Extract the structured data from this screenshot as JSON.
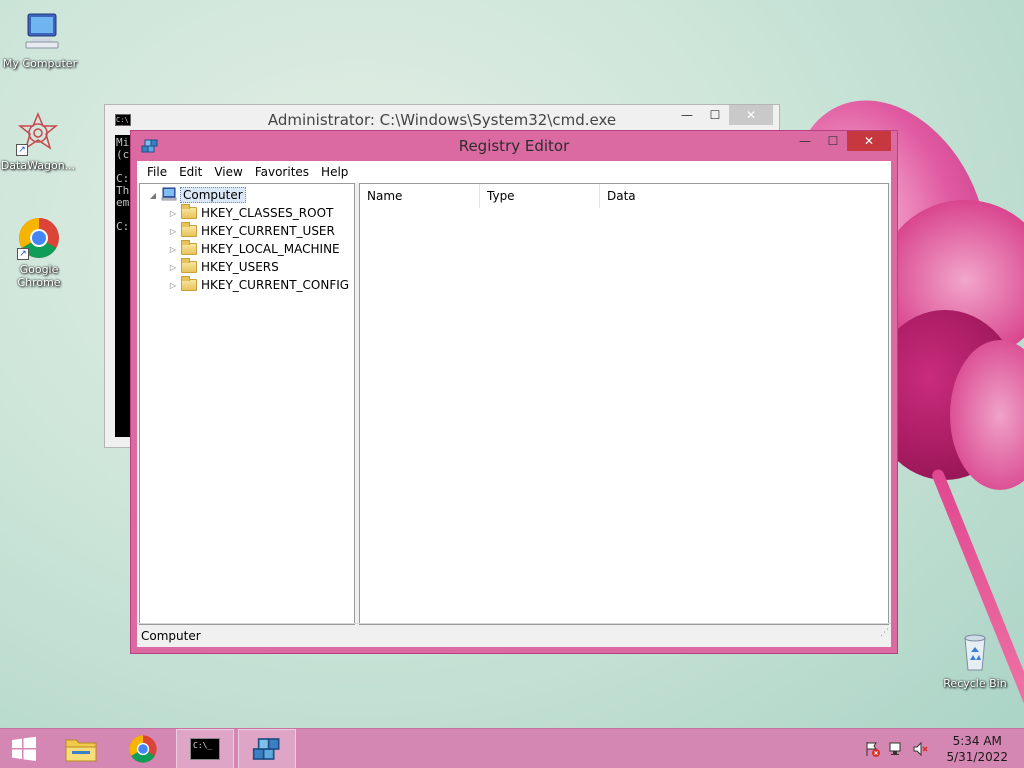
{
  "desktop": {
    "icons": [
      {
        "label": "My Computer"
      },
      {
        "label": "DataWagon..."
      },
      {
        "label": "Google Chrome"
      },
      {
        "label": "Recycle Bin"
      }
    ]
  },
  "cmd_window": {
    "title": "Administrator: C:\\Windows\\System32\\cmd.exe",
    "console_lines": [
      "Mi",
      "(c",
      "",
      "C:",
      "Th",
      "em",
      "",
      "C:"
    ]
  },
  "regedit": {
    "title": "Registry Editor",
    "menu": [
      "File",
      "Edit",
      "View",
      "Favorites",
      "Help"
    ],
    "tree_root": "Computer",
    "tree_items": [
      "HKEY_CLASSES_ROOT",
      "HKEY_CURRENT_USER",
      "HKEY_LOCAL_MACHINE",
      "HKEY_USERS",
      "HKEY_CURRENT_CONFIG"
    ],
    "columns": [
      "Name",
      "Type",
      "Data"
    ],
    "status": "Computer"
  },
  "taskbar": {
    "time": "5:34 AM",
    "date": "5/31/2022"
  },
  "colors": {
    "window_accent": "#db6aa3",
    "close_button": "#c7373f",
    "taskbar": "#d587b3"
  }
}
